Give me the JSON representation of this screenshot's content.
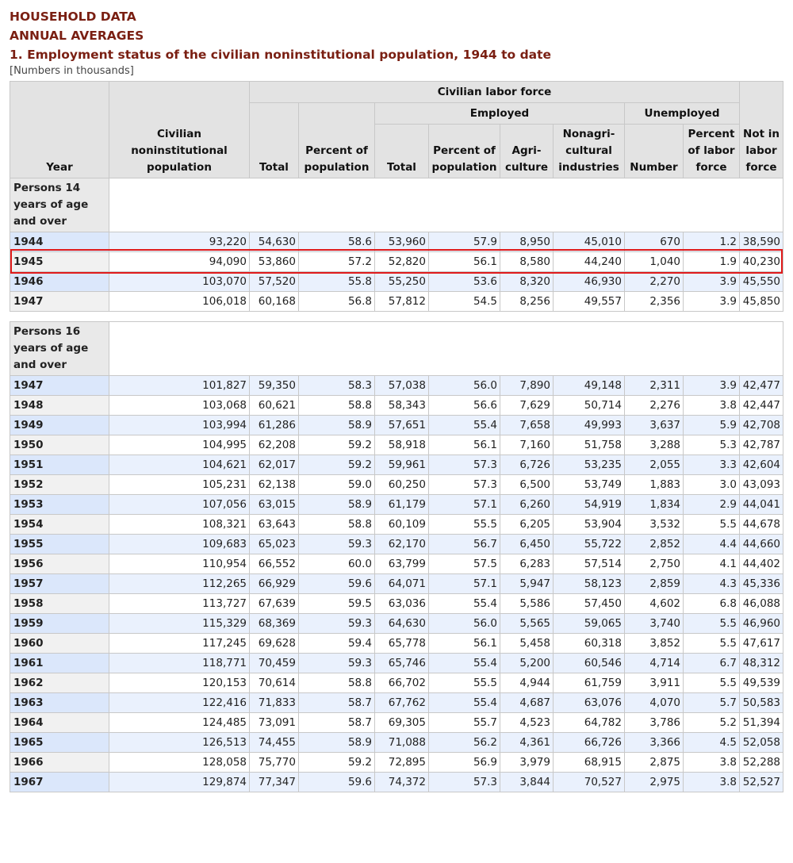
{
  "header": {
    "line1": "HOUSEHOLD DATA",
    "line2": "ANNUAL AVERAGES",
    "line3": "1. Employment status of the civilian noninstitutional population, 1944 to date",
    "note": "[Numbers in thousands]"
  },
  "columns": {
    "year": "Year",
    "population": "Civilian noninstitutional population",
    "labor_force_group": "Civilian labor force",
    "total": "Total",
    "percent_population": "Percent of population",
    "employed_group": "Employed",
    "emp_total": "Total",
    "emp_percent_population": "Percent of population",
    "agriculture": "Agri- culture",
    "nonag": "Nonagri- cultural industries",
    "unemployed_group": "Unemployed",
    "unemp_number": "Number",
    "unemp_percent": "Percent of labor force",
    "not_in_lf": "Not in labor force"
  },
  "sections": [
    {
      "label": "Persons 14 years of age and over",
      "rows": [
        [
          "1944",
          "93,220",
          "54,630",
          "58.6",
          "53,960",
          "57.9",
          "8,950",
          "45,010",
          "670",
          "1.2",
          "38,590"
        ],
        [
          "1945",
          "94,090",
          "53,860",
          "57.2",
          "52,820",
          "56.1",
          "8,580",
          "44,240",
          "1,040",
          "1.9",
          "40,230"
        ],
        [
          "1946",
          "103,070",
          "57,520",
          "55.8",
          "55,250",
          "53.6",
          "8,320",
          "46,930",
          "2,270",
          "3.9",
          "45,550"
        ],
        [
          "1947",
          "106,018",
          "60,168",
          "56.8",
          "57,812",
          "54.5",
          "8,256",
          "49,557",
          "2,356",
          "3.9",
          "45,850"
        ]
      ]
    },
    {
      "label": "Persons 16 years of age and over",
      "rows": [
        [
          "1947",
          "101,827",
          "59,350",
          "58.3",
          "57,038",
          "56.0",
          "7,890",
          "49,148",
          "2,311",
          "3.9",
          "42,477"
        ],
        [
          "1948",
          "103,068",
          "60,621",
          "58.8",
          "58,343",
          "56.6",
          "7,629",
          "50,714",
          "2,276",
          "3.8",
          "42,447"
        ],
        [
          "1949",
          "103,994",
          "61,286",
          "58.9",
          "57,651",
          "55.4",
          "7,658",
          "49,993",
          "3,637",
          "5.9",
          "42,708"
        ],
        [
          "1950",
          "104,995",
          "62,208",
          "59.2",
          "58,918",
          "56.1",
          "7,160",
          "51,758",
          "3,288",
          "5.3",
          "42,787"
        ],
        [
          "1951",
          "104,621",
          "62,017",
          "59.2",
          "59,961",
          "57.3",
          "6,726",
          "53,235",
          "2,055",
          "3.3",
          "42,604"
        ],
        [
          "1952",
          "105,231",
          "62,138",
          "59.0",
          "60,250",
          "57.3",
          "6,500",
          "53,749",
          "1,883",
          "3.0",
          "43,093"
        ],
        [
          "1953",
          "107,056",
          "63,015",
          "58.9",
          "61,179",
          "57.1",
          "6,260",
          "54,919",
          "1,834",
          "2.9",
          "44,041"
        ],
        [
          "1954",
          "108,321",
          "63,643",
          "58.8",
          "60,109",
          "55.5",
          "6,205",
          "53,904",
          "3,532",
          "5.5",
          "44,678"
        ],
        [
          "1955",
          "109,683",
          "65,023",
          "59.3",
          "62,170",
          "56.7",
          "6,450",
          "55,722",
          "2,852",
          "4.4",
          "44,660"
        ],
        [
          "1956",
          "110,954",
          "66,552",
          "60.0",
          "63,799",
          "57.5",
          "6,283",
          "57,514",
          "2,750",
          "4.1",
          "44,402"
        ],
        [
          "1957",
          "112,265",
          "66,929",
          "59.6",
          "64,071",
          "57.1",
          "5,947",
          "58,123",
          "2,859",
          "4.3",
          "45,336"
        ],
        [
          "1958",
          "113,727",
          "67,639",
          "59.5",
          "63,036",
          "55.4",
          "5,586",
          "57,450",
          "4,602",
          "6.8",
          "46,088"
        ],
        [
          "1959",
          "115,329",
          "68,369",
          "59.3",
          "64,630",
          "56.0",
          "5,565",
          "59,065",
          "3,740",
          "5.5",
          "46,960"
        ],
        [
          "1960",
          "117,245",
          "69,628",
          "59.4",
          "65,778",
          "56.1",
          "5,458",
          "60,318",
          "3,852",
          "5.5",
          "47,617"
        ],
        [
          "1961",
          "118,771",
          "70,459",
          "59.3",
          "65,746",
          "55.4",
          "5,200",
          "60,546",
          "4,714",
          "6.7",
          "48,312"
        ],
        [
          "1962",
          "120,153",
          "70,614",
          "58.8",
          "66,702",
          "55.5",
          "4,944",
          "61,759",
          "3,911",
          "5.5",
          "49,539"
        ],
        [
          "1963",
          "122,416",
          "71,833",
          "58.7",
          "67,762",
          "55.4",
          "4,687",
          "63,076",
          "4,070",
          "5.7",
          "50,583"
        ],
        [
          "1964",
          "124,485",
          "73,091",
          "58.7",
          "69,305",
          "55.7",
          "4,523",
          "64,782",
          "3,786",
          "5.2",
          "51,394"
        ],
        [
          "1965",
          "126,513",
          "74,455",
          "58.9",
          "71,088",
          "56.2",
          "4,361",
          "66,726",
          "3,366",
          "4.5",
          "52,058"
        ],
        [
          "1966",
          "128,058",
          "75,770",
          "59.2",
          "72,895",
          "56.9",
          "3,979",
          "68,915",
          "2,875",
          "3.8",
          "52,288"
        ],
        [
          "1967",
          "129,874",
          "77,347",
          "59.6",
          "74,372",
          "57.3",
          "3,844",
          "70,527",
          "2,975",
          "3.8",
          "52,527"
        ]
      ]
    }
  ]
}
